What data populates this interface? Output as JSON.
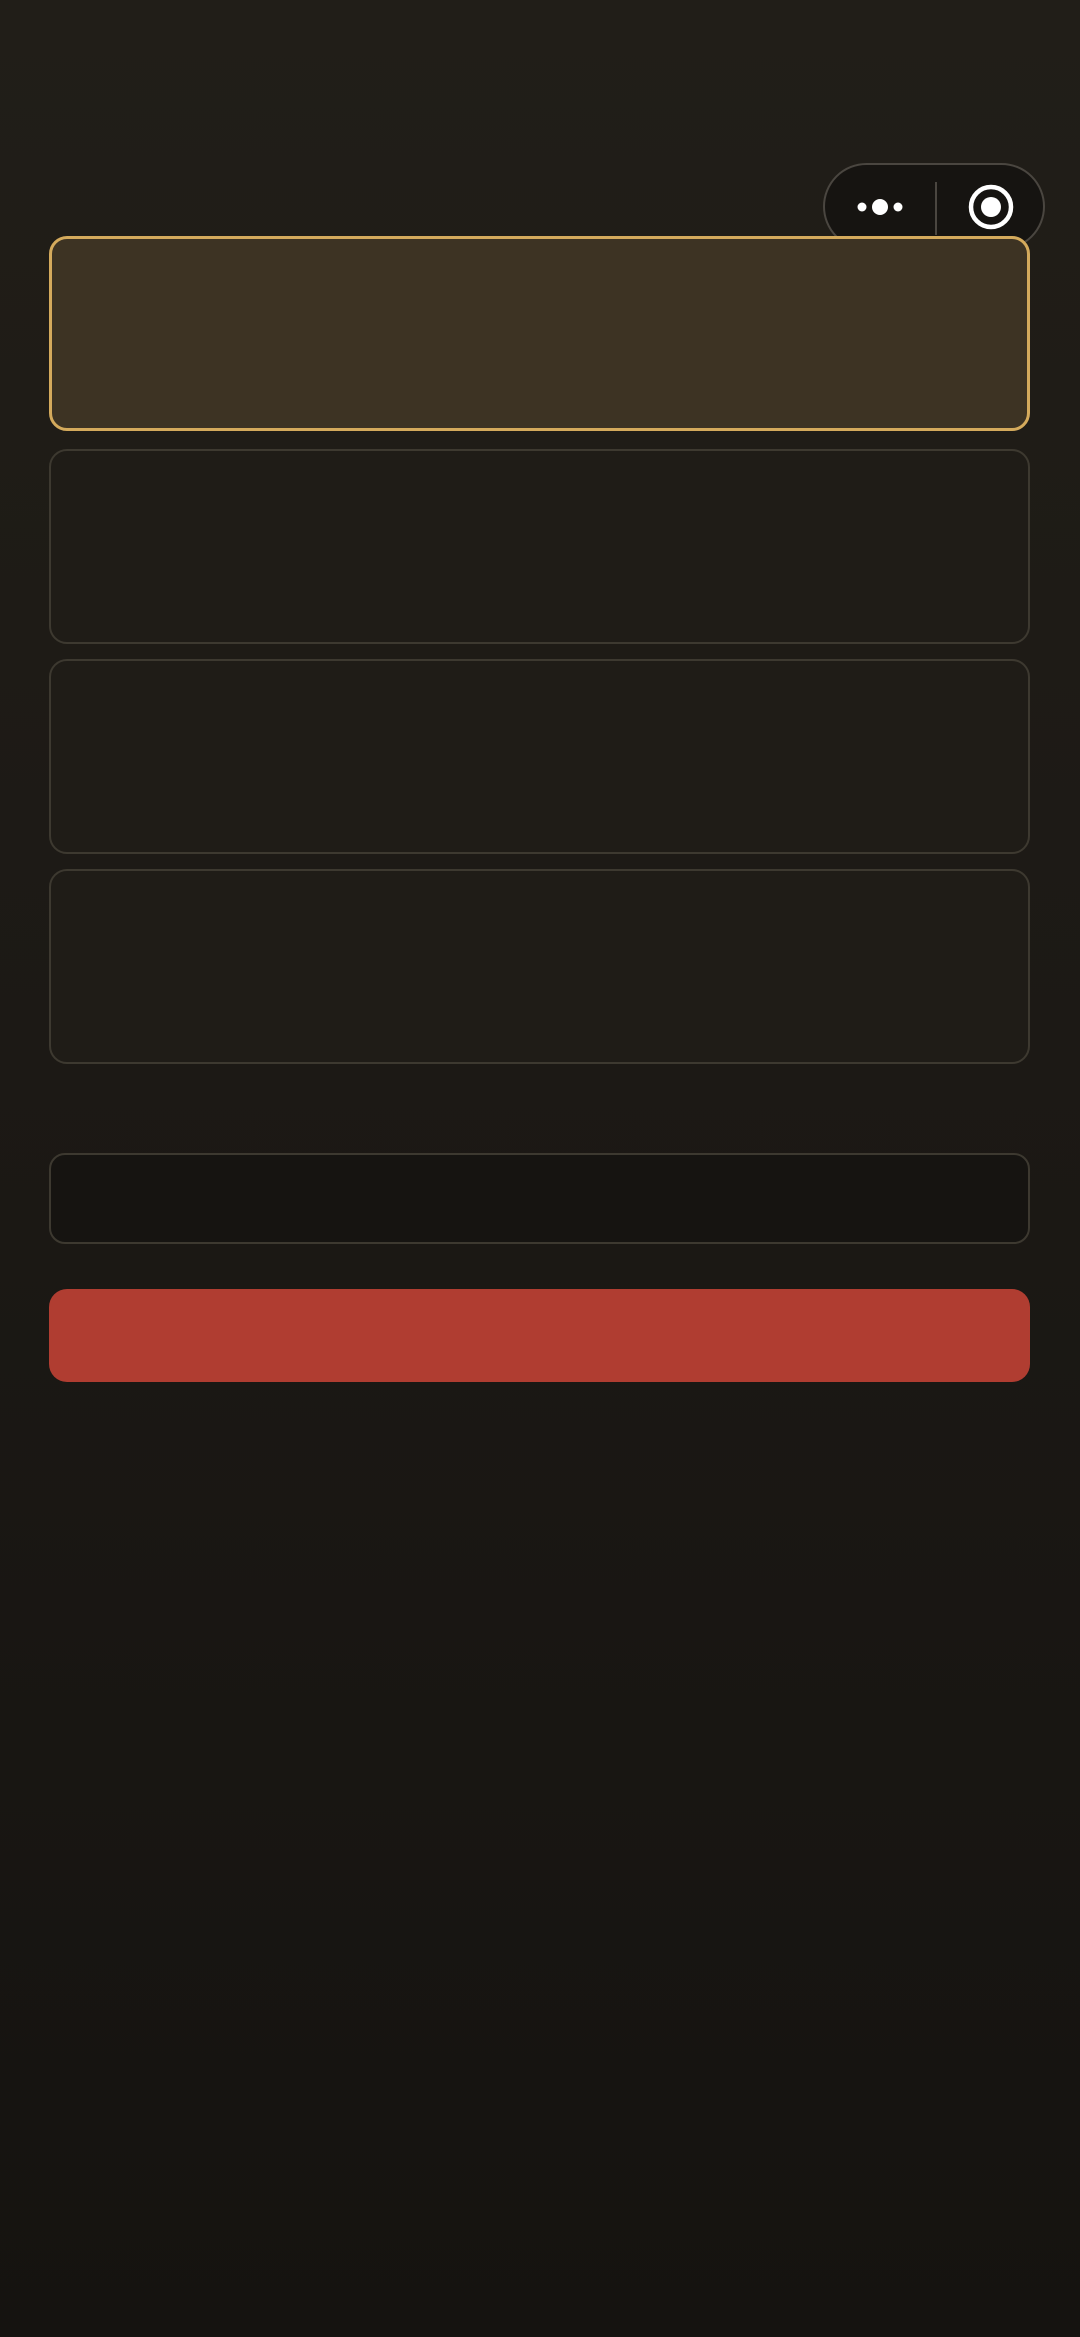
{
  "capsule": {
    "more_icon": "more-dots-icon",
    "close_icon": "close-target-icon"
  },
  "options": [
    {
      "label": "",
      "selected": true
    },
    {
      "label": "",
      "selected": false
    },
    {
      "label": "",
      "selected": false
    },
    {
      "label": "",
      "selected": false
    }
  ],
  "input": {
    "value": "",
    "placeholder": ""
  },
  "submit": {
    "label": ""
  },
  "colors": {
    "accent_gold": "#d4aa5c",
    "selected_fill": "#3d3323",
    "submit_red": "#b03d31",
    "background": "#1c1915",
    "card_border": "#3d3930"
  }
}
